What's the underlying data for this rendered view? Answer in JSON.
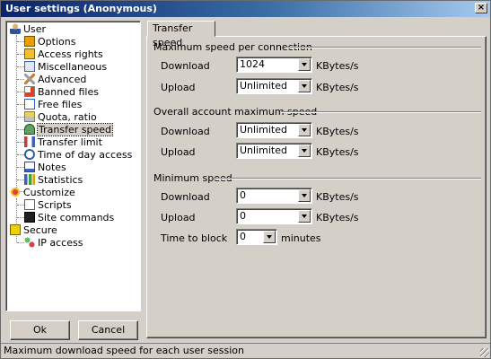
{
  "window": {
    "title": "User settings (Anonymous)",
    "close_glyph": "×"
  },
  "tree": {
    "items": [
      {
        "label": "User",
        "icon": "user-icon",
        "level": 0
      },
      {
        "label": "Options",
        "icon": "options-icon",
        "level": 1
      },
      {
        "label": "Access rights",
        "icon": "access-rights-icon",
        "level": 1
      },
      {
        "label": "Miscellaneous",
        "icon": "miscellaneous-icon",
        "level": 1
      },
      {
        "label": "Advanced",
        "icon": "advanced-icon",
        "level": 1
      },
      {
        "label": "Banned files",
        "icon": "banned-files-icon",
        "level": 1
      },
      {
        "label": "Free files",
        "icon": "free-files-icon",
        "level": 1
      },
      {
        "label": "Quota, ratio",
        "icon": "quota-icon",
        "level": 1
      },
      {
        "label": "Transfer speed",
        "icon": "speedometer-icon",
        "level": 1,
        "selected": true
      },
      {
        "label": "Transfer limit",
        "icon": "transfer-limit-icon",
        "level": 1
      },
      {
        "label": "Time of day access",
        "icon": "clock-icon",
        "level": 1
      },
      {
        "label": "Notes",
        "icon": "notes-icon",
        "level": 1
      },
      {
        "label": "Statistics",
        "icon": "statistics-icon",
        "level": 1
      },
      {
        "label": "Customize",
        "icon": "customize-icon",
        "level": 0
      },
      {
        "label": "Scripts",
        "icon": "scripts-icon",
        "level": 1
      },
      {
        "label": "Site commands",
        "icon": "site-commands-icon",
        "level": 1
      },
      {
        "label": "Secure",
        "icon": "secure-icon",
        "level": 0
      },
      {
        "label": "IP access",
        "icon": "ip-access-icon",
        "level": 1
      }
    ]
  },
  "buttons": {
    "ok": "Ok",
    "cancel": "Cancel"
  },
  "tab": {
    "label": "Transfer speed"
  },
  "sections": {
    "max_per_connection": {
      "title": "Maximum speed per connection",
      "download_label": "Download",
      "download_value": "1024",
      "upload_label": "Upload",
      "upload_value": "Unlimited",
      "unit": "KBytes/s"
    },
    "overall_max": {
      "title": "Overall account maximum speed",
      "download_label": "Download",
      "download_value": "Unlimited",
      "upload_label": "Upload",
      "upload_value": "Unlimited",
      "unit": "KBytes/s"
    },
    "minimum": {
      "title": "Minimum speed",
      "download_label": "Download",
      "download_value": "0",
      "upload_label": "Upload",
      "upload_value": "0",
      "unit": "KBytes/s",
      "time_label": "Time to block",
      "time_value": "0",
      "time_unit": "minutes"
    }
  },
  "statusbar": {
    "text": "Maximum download speed for each user session"
  }
}
